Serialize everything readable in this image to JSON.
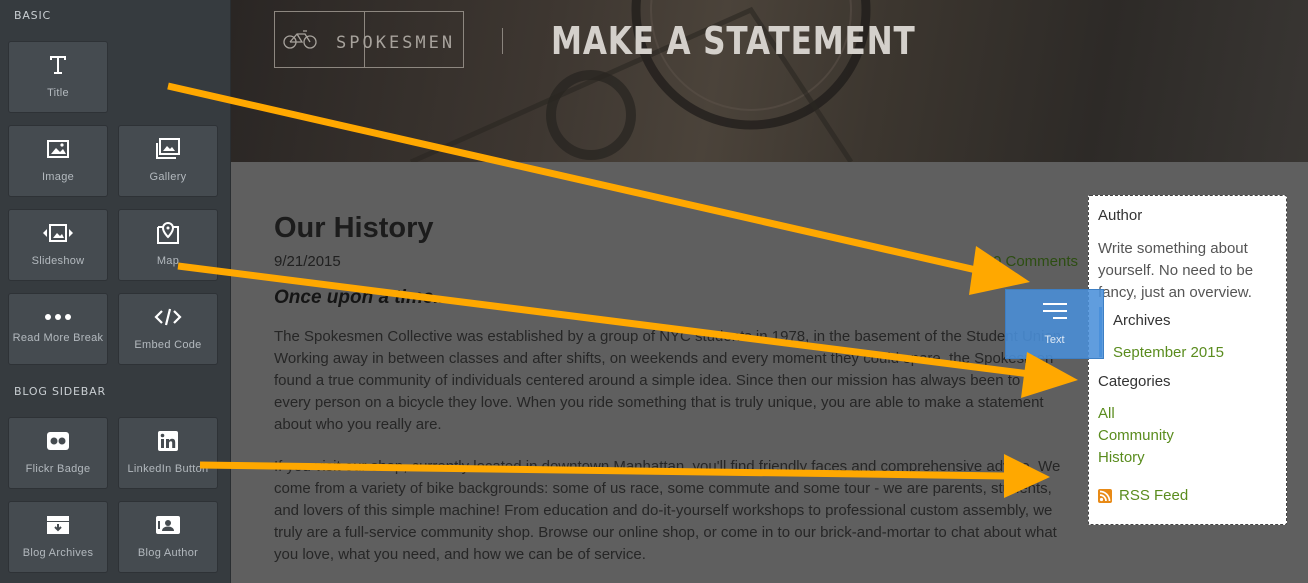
{
  "sidebar": {
    "sections": [
      {
        "title": "BASIC",
        "tiles": [
          {
            "label": "Title",
            "icon": "text-t-icon"
          },
          {
            "label": "Image",
            "icon": "image-icon"
          },
          {
            "label": "Gallery",
            "icon": "gallery-icon"
          },
          {
            "label": "Slideshow",
            "icon": "slideshow-icon"
          },
          {
            "label": "Map",
            "icon": "map-pin-icon"
          },
          {
            "label": "Read More Break",
            "icon": "ellipsis-icon"
          },
          {
            "label": "Embed Code",
            "icon": "code-icon"
          }
        ]
      },
      {
        "title": "BLOG SIDEBAR",
        "tiles": [
          {
            "label": "Flickr Badge",
            "icon": "flickr-icon"
          },
          {
            "label": "LinkedIn Button",
            "icon": "linkedin-icon"
          },
          {
            "label": "Blog Archives",
            "icon": "archive-icon"
          },
          {
            "label": "Blog Author",
            "icon": "author-card-icon"
          }
        ]
      }
    ]
  },
  "header": {
    "logo_text": "SPOKESMEN",
    "title": "MAKE A STATEMENT"
  },
  "post": {
    "title": "Our History",
    "date": "9/21/2015",
    "comments": "0 Comments",
    "subtitle": "Once upon a time...",
    "paragraphs": [
      "The Spokesmen Collective was established by a group of NYC students in 1978, in the basement of the Student Union. Working away in between classes and after shifts, on weekends and every moment they could spare, the Spokesmen found a true community of individuals centered around a simple idea. Since then our mission has always been to get every person on a bicycle they love. When you ride something that is truly unique, you are able to make a statement about who you really are.",
      "If you visit our shop, currently located in downtown Manhattan, you'll find friendly faces and comprehensive advice. We come from a variety of bike backgrounds: some of us race, some commute and some tour - we are parents, students, and lovers of this simple machine! From education and do-it-yourself workshops to professional custom assembly, we truly are a full-service community shop. Browse our online shop, or come in to our brick-and-mortar to chat about what you love, what you need, and how we can be of service."
    ]
  },
  "blog_sidebar": {
    "author_heading": "Author",
    "author_text": "Write something about yourself. No need to be fancy, just an overview.",
    "archives_heading": "Archives",
    "archives": [
      "September 2015"
    ],
    "categories_heading": "Categories",
    "categories": [
      "All",
      "Community",
      "History"
    ],
    "rss_label": "RSS Feed"
  },
  "drag_tile": {
    "label": "Text",
    "icon": "text-lines-icon"
  },
  "colors": {
    "sidebar_bg": "#363b3f",
    "tile_bg": "#454b50",
    "link_green": "#5a8c1e",
    "drag_blue": "#4a90d9",
    "arrow_orange": "#ffa800"
  }
}
